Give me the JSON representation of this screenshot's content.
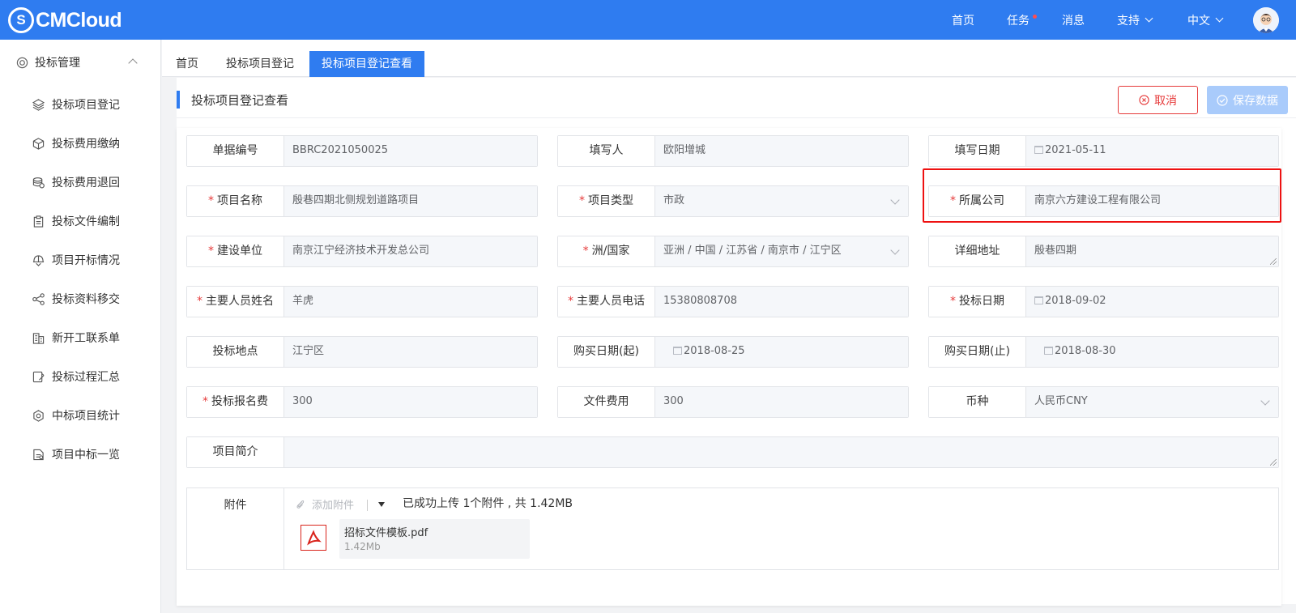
{
  "app": {
    "logo_mark": "S",
    "logo_text": "CMCloud"
  },
  "topnav": {
    "home": "首页",
    "tasks": "任务",
    "messages": "消息",
    "support": "支持",
    "language": "中文"
  },
  "sidebar": {
    "group": "投标管理",
    "items": [
      {
        "label": "投标项目登记",
        "icon": "layers-icon"
      },
      {
        "label": "投标费用缴纳",
        "icon": "cube-icon"
      },
      {
        "label": "投标费用退回",
        "icon": "coins-icon"
      },
      {
        "label": "投标文件编制",
        "icon": "clipboard-icon"
      },
      {
        "label": "项目开标情况",
        "icon": "helmet-icon"
      },
      {
        "label": "投标资料移交",
        "icon": "share-icon"
      },
      {
        "label": "新开工联系单",
        "icon": "building-icon"
      },
      {
        "label": "投标过程汇总",
        "icon": "edit-doc-icon"
      },
      {
        "label": "中标项目统计",
        "icon": "hexagon-icon"
      },
      {
        "label": "项目中标一览",
        "icon": "document-icon"
      }
    ]
  },
  "tabs": [
    "首页",
    "投标项目登记",
    "投标项目登记查看"
  ],
  "page": {
    "title": "投标项目登记查看",
    "cancel_label": "取消",
    "save_label": "保存数据"
  },
  "form": {
    "bill_no": {
      "label": "单据编号",
      "value": "BBRC2021050025"
    },
    "writer": {
      "label": "填写人",
      "value": "欧阳增城"
    },
    "write_date": {
      "label": "填写日期",
      "value": "2021-05-11"
    },
    "project_name": {
      "label": "项目名称",
      "value": "殷巷四期北侧规划道路项目"
    },
    "project_type": {
      "label": "项目类型",
      "value": "市政"
    },
    "company": {
      "label": "所属公司",
      "value": "南京六方建设工程有限公司"
    },
    "builder": {
      "label": "建设单位",
      "value": "南京江宁经济技术开发总公司"
    },
    "region": {
      "label": "洲/国家",
      "value": "亚洲 / 中国 / 江苏省 / 南京市 / 江宁区"
    },
    "address": {
      "label": "详细地址",
      "value": "殷巷四期"
    },
    "main_person": {
      "label": "主要人员姓名",
      "value": "羊虎"
    },
    "main_phone": {
      "label": "主要人员电话",
      "value": "15380808708"
    },
    "bid_date": {
      "label": "投标日期",
      "value": "2018-09-02"
    },
    "bid_place": {
      "label": "投标地点",
      "value": "江宁区"
    },
    "buy_start": {
      "label": "购买日期(起)",
      "value": "2018-08-25"
    },
    "buy_end": {
      "label": "购买日期(止)",
      "value": "2018-08-30"
    },
    "signup_fee": {
      "label": "投标报名费",
      "value": "300"
    },
    "doc_fee": {
      "label": "文件费用",
      "value": "300"
    },
    "currency": {
      "label": "币种",
      "value": "人民币CNY"
    },
    "intro": {
      "label": "项目简介",
      "value": ""
    }
  },
  "attachment": {
    "label": "附件",
    "add_label": "添加附件",
    "status": "已成功上传 1个附件 , 共 1.42MB",
    "files": [
      {
        "name": "招标文件模板.pdf",
        "size": "1.42Mb"
      }
    ]
  },
  "colors": {
    "primary": "#2f7cf0",
    "danger": "#e63b3b",
    "save_disabled": "#a9cbfb"
  }
}
